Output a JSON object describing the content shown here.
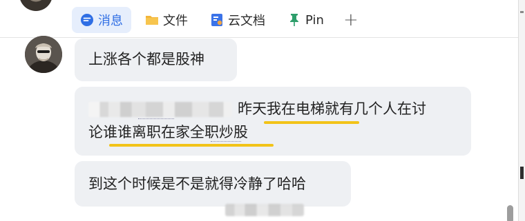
{
  "tabs": [
    {
      "label": "消息",
      "icon": "message-icon",
      "active": true
    },
    {
      "label": "文件",
      "icon": "folder-icon",
      "active": false
    },
    {
      "label": "云文档",
      "icon": "cloud-doc-icon",
      "active": false
    },
    {
      "label": "Pin",
      "icon": "pin-icon",
      "active": false
    }
  ],
  "add_tab_label": "+",
  "messages": [
    {
      "text": "上涨各个都是股神"
    },
    {
      "line1": "昨天我在电梯就有几个人在讨",
      "line2": "论谁谁离职在家全职炒股",
      "redacted_sender": true
    },
    {
      "text": "到这个时候是不是就得冷静了哈哈"
    }
  ],
  "colors": {
    "accent": "#2f6ee4",
    "active_tab_bg": "#e6eefc",
    "bubble_bg": "#eef0f3",
    "highlight": "#f2c318",
    "folder": "#f3b53a",
    "pin": "#2e9e6b"
  }
}
